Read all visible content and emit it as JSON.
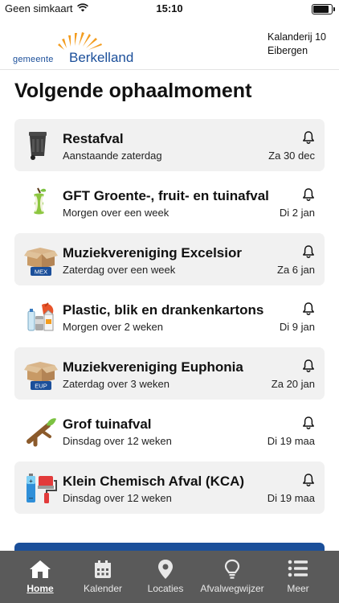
{
  "status_bar": {
    "carrier": "Geen simkaart",
    "time": "15:10"
  },
  "header": {
    "logo_prefix": "gemeente",
    "logo_name": "Berkelland",
    "address_line1": "Kalanderij 10",
    "address_line2": "Eibergen"
  },
  "section_title": "Volgende ophaalmoment",
  "items": [
    {
      "title": "Restafval",
      "subtitle": "Aanstaande zaterdag",
      "date": "Za 30 dec",
      "icon": "trash-bin-icon"
    },
    {
      "title": "GFT Groente-, fruit- en tuinafval",
      "subtitle": "Morgen over een week",
      "date": "Di 2 jan",
      "icon": "apple-core-icon"
    },
    {
      "title": "Muziekvereniging Excelsior",
      "subtitle": "Zaterdag over een week",
      "date": "Za 6 jan",
      "icon": "box-icon",
      "badge": "MEX"
    },
    {
      "title": "Plastic, blik en drankenkartons",
      "subtitle": "Morgen over 2 weken",
      "date": "Di 9 jan",
      "icon": "plastic-can-carton-icon"
    },
    {
      "title": "Muziekvereniging Euphonia",
      "subtitle": "Zaterdag over 3 weken",
      "date": "Za 20 jan",
      "icon": "box-icon",
      "badge": "EUP"
    },
    {
      "title": "Grof tuinafval",
      "subtitle": "Dinsdag over 12 weken",
      "date": "Di 19 maa",
      "icon": "branch-icon"
    },
    {
      "title": "Klein Chemisch Afval (KCA)",
      "subtitle": "Dinsdag over 12 weken",
      "date": "Di 19 maa",
      "icon": "battery-paintbrush-icon"
    }
  ],
  "tabs": [
    {
      "label": "Home",
      "icon": "home-icon",
      "active": true
    },
    {
      "label": "Kalender",
      "icon": "calendar-icon"
    },
    {
      "label": "Locaties",
      "icon": "location-pin-icon"
    },
    {
      "label": "Afvalwegwijzer",
      "icon": "lightbulb-icon"
    },
    {
      "label": "Meer",
      "icon": "menu-list-icon"
    }
  ],
  "colors": {
    "brand_blue": "#1b4f9a",
    "brand_orange": "#f39c1e",
    "tabbar": "#5a5a5a",
    "card_shade": "#f1f1f1"
  }
}
